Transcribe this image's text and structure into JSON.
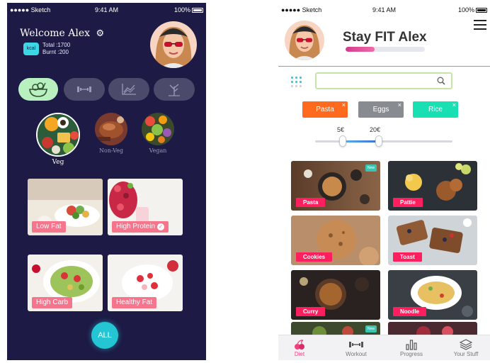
{
  "left": {
    "status_bar": {
      "carrier": "●●●●● Sketch",
      "time": "9:41 AM",
      "battery": "100%"
    },
    "welcome": "Welcome Alex",
    "kcal_badge": "kcal",
    "total_line": "Total  :1700",
    "burnt_line": "Burnt  :200",
    "categories": [
      {
        "icon": "salad-bowl-icon",
        "active": true
      },
      {
        "icon": "dumbbell-icon",
        "active": false
      },
      {
        "icon": "chart-icon",
        "active": false
      },
      {
        "icon": "tree-icon",
        "active": false
      }
    ],
    "diet_types": [
      {
        "label": "Veg",
        "active": true
      },
      {
        "label": "Non-Veg",
        "active": false
      },
      {
        "label": "Vegan",
        "active": false
      }
    ],
    "food_tiles": [
      {
        "label": "Low Fat",
        "checked": false
      },
      {
        "label": "High Protein",
        "checked": true
      },
      {
        "label": "High Carb",
        "checked": false
      },
      {
        "label": "Healthy Fat",
        "checked": false
      }
    ],
    "all_button": "ALL",
    "colors": {
      "background": "#1d1a45",
      "accent": "#23c6d2",
      "label": "#f4758c",
      "active_pill": "#b8f0c0"
    }
  },
  "right": {
    "status_bar": {
      "carrier": "●●●●● Sketch",
      "time": "9:41 AM",
      "battery": "100%"
    },
    "title": "Stay FIT Alex",
    "progress": 0.37,
    "search": {
      "value": "",
      "placeholder": ""
    },
    "chips": [
      {
        "label": "Pasta",
        "color": "#ff6a1f"
      },
      {
        "label": "Eggs",
        "color": "#888c90"
      },
      {
        "label": "Rice",
        "color": "#19e0b2"
      }
    ],
    "chip_close": "×",
    "price": {
      "min": "5€",
      "max": "20€"
    },
    "recipes": [
      {
        "label": "Pasta",
        "new": true
      },
      {
        "label": "Pattie",
        "new": false
      },
      {
        "label": "Cookies",
        "new": false
      },
      {
        "label": "Toast",
        "new": false
      },
      {
        "label": "Curry",
        "new": false
      },
      {
        "label": "Noodle",
        "new": false
      }
    ],
    "new_badge": "New",
    "tabs": [
      {
        "label": "Diet",
        "icon": "cherries-icon",
        "active": true
      },
      {
        "label": "Workout",
        "icon": "dumbbell-icon",
        "active": false
      },
      {
        "label": "Progress",
        "icon": "bar-chart-icon",
        "active": false
      },
      {
        "label": "Your Stuff",
        "icon": "layers-icon",
        "active": false
      }
    ],
    "colors": {
      "accent": "#f2417f",
      "label": "#ff1f5e",
      "slider": "#3c70d8"
    }
  }
}
